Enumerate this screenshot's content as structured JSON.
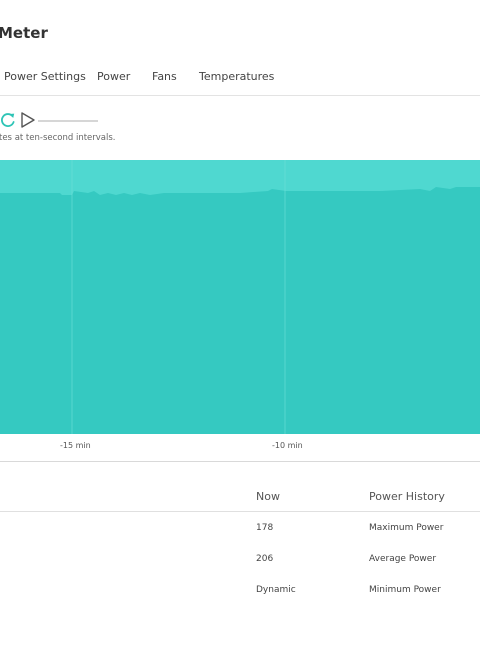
{
  "page": {
    "title": "Meter"
  },
  "tabs": [
    {
      "label": "Power Settings"
    },
    {
      "label": "Power"
    },
    {
      "label": "Fans"
    },
    {
      "label": "Temperatures"
    }
  ],
  "controls": {
    "refresh_icon": "refresh-icon",
    "play_icon": "play-icon"
  },
  "interval_note": "tes at ten-second intervals.",
  "colors": {
    "accent": "#2ec4b6",
    "chart_top_band": "#4fd8d0",
    "chart_fill": "#35c9c1"
  },
  "chart_data": {
    "type": "area",
    "x_tick_labels": [
      "-15 min",
      "-10 min"
    ],
    "grid": true,
    "legend": "none"
  },
  "table": {
    "headers": {
      "now": "Now",
      "history": "Power History"
    },
    "rows": [
      {
        "now": "178",
        "history": "Maximum Power"
      },
      {
        "now": "206",
        "history": "Average Power"
      },
      {
        "now": "Dynamic",
        "history": "Minimum Power"
      }
    ]
  }
}
